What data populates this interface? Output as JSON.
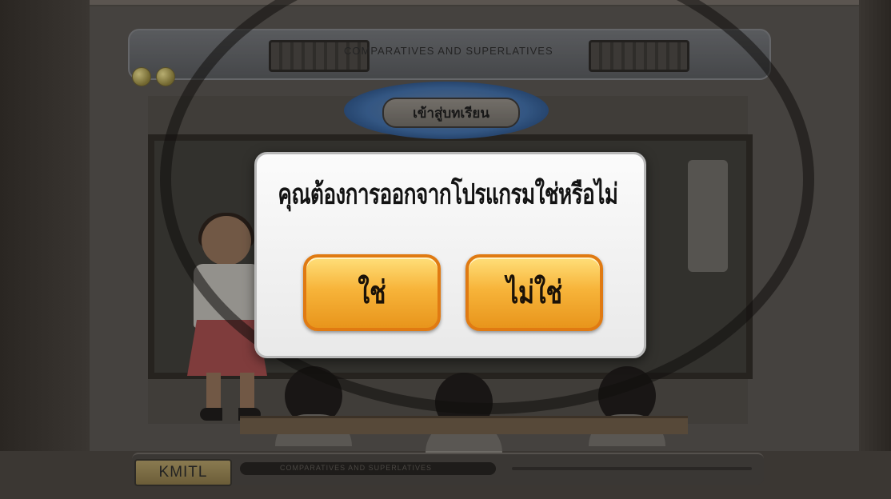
{
  "app": {
    "title": "COMPARATIVES AND SUPERLATIVES",
    "lesson_button_label": "เข้าสู่บทเรียน",
    "footer_badge": "KMITL",
    "footer_text": "COMPARATIVES AND SUPERLATIVES"
  },
  "dialog": {
    "question": "คุณต้องการออกจากโปรแกรมใช่หรือไม่",
    "yes_label": "ใช่",
    "no_label": "ไม่ใช่"
  },
  "colors": {
    "button_fill": "#f7b43a",
    "button_border": "#e07a12",
    "dialog_bg": "#f5f5f5",
    "lesson_ring": "#3f6aa0"
  }
}
